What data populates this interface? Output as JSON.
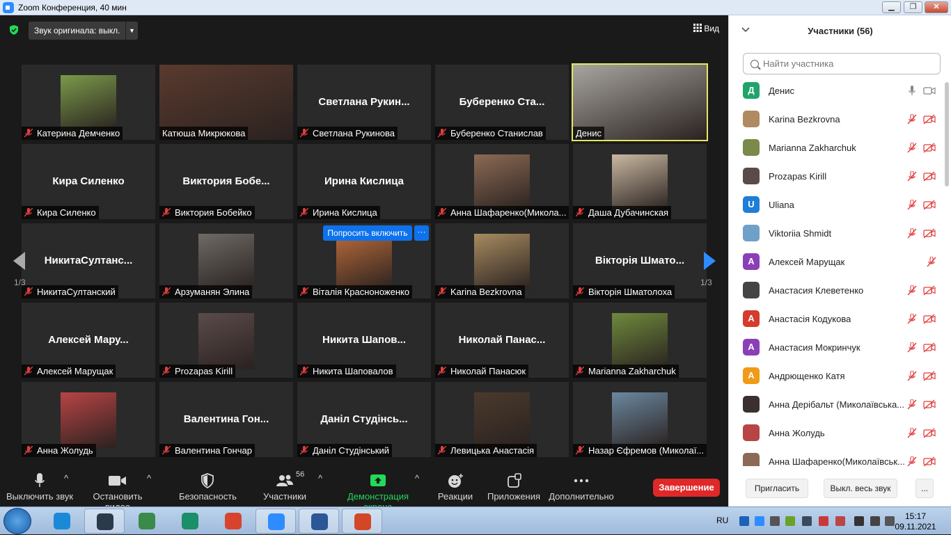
{
  "window": {
    "title": "Zoom Конференция, 40 мин",
    "btn_min": "▁",
    "btn_max": "❐",
    "btn_close": "✕"
  },
  "topbar": {
    "audio_label": "Звук оригинала: выкл.",
    "audio_caret": "▼",
    "view_label": "Вид"
  },
  "pager": {
    "left_text": "1/3",
    "right_text": "1/3"
  },
  "tiles": [
    {
      "name": "Катерина Демченко",
      "muted": true,
      "kind": "photo",
      "center_name": "",
      "tone": "#7a9a4a"
    },
    {
      "name": "Катюша Микрюкова",
      "muted": false,
      "kind": "full",
      "center_name": "",
      "tone": "#5a3a2e"
    },
    {
      "name": "Светлана Рукинова",
      "muted": true,
      "kind": "text",
      "center_name": "Светлана  Рукин...",
      "tone": ""
    },
    {
      "name": "Буберенко Станислав",
      "muted": true,
      "kind": "text",
      "center_name": "Буберенко  Ста...",
      "tone": ""
    },
    {
      "name": "Денис",
      "muted": false,
      "kind": "full",
      "center_name": "",
      "tone": "#a8a5a0",
      "active": true
    },
    {
      "name": "Кира Силенко",
      "muted": true,
      "kind": "text",
      "center_name": "Кира Силенко",
      "tone": ""
    },
    {
      "name": "Виктория Бобейко",
      "muted": true,
      "kind": "text",
      "center_name": "Виктория  Бобе...",
      "tone": ""
    },
    {
      "name": "Ирина Кислица",
      "muted": true,
      "kind": "text",
      "center_name": "Ирина Кислица",
      "tone": ""
    },
    {
      "name": "Анна Шафаренко(Микола...",
      "muted": true,
      "kind": "photo",
      "center_name": "",
      "tone": "#8c6a55"
    },
    {
      "name": "Даша Дубачинская",
      "muted": true,
      "kind": "photo",
      "center_name": "",
      "tone": "#c9b8a2"
    },
    {
      "name": "НикитаСултанский",
      "muted": true,
      "kind": "text",
      "center_name": "НикитаСултанс...",
      "tone": ""
    },
    {
      "name": "Арзуманян Элина",
      "muted": true,
      "kind": "photo",
      "center_name": "",
      "tone": "#6e6a66"
    },
    {
      "name": "Віталія Красноноженко",
      "muted": true,
      "kind": "photo",
      "center_name": "",
      "tone": "#b86a3a"
    },
    {
      "name": "Karina Bezkrovna",
      "muted": true,
      "kind": "photo",
      "center_name": "",
      "tone": "#a88b60"
    },
    {
      "name": "Вікторія Шматолоха",
      "muted": true,
      "kind": "text",
      "center_name": "Вікторія  Шмато...",
      "tone": ""
    },
    {
      "name": "Алексей Марущак",
      "muted": true,
      "kind": "text",
      "center_name": "Алексей  Мару...",
      "tone": ""
    },
    {
      "name": "Prozapas Kirill",
      "muted": true,
      "kind": "photo",
      "center_name": "",
      "tone": "#5c4b4b"
    },
    {
      "name": "Никита Шаповалов",
      "muted": true,
      "kind": "text",
      "center_name": "Никита  Шапов...",
      "tone": ""
    },
    {
      "name": "Николай Панасюк",
      "muted": true,
      "kind": "text",
      "center_name": "Николай  Панас...",
      "tone": ""
    },
    {
      "name": "Marianna Zakharchuk",
      "muted": true,
      "kind": "photo",
      "center_name": "",
      "tone": "#6f8a3c"
    },
    {
      "name": "Анна Жолудь",
      "muted": true,
      "kind": "photo",
      "center_name": "",
      "tone": "#b84444"
    },
    {
      "name": "Валентина Гончар",
      "muted": true,
      "kind": "text",
      "center_name": "Валентина  Гон...",
      "tone": ""
    },
    {
      "name": "Даніл Студінський",
      "muted": true,
      "kind": "text",
      "center_name": "Даніл  Студінсь...",
      "tone": ""
    },
    {
      "name": "Левицька Анастасія",
      "muted": true,
      "kind": "photo",
      "center_name": "",
      "tone": "#4a3a2c"
    },
    {
      "name": "Назар Єфремов (Миколаї...",
      "muted": true,
      "kind": "photo",
      "center_name": "",
      "tone": "#6b88a0"
    }
  ],
  "ask_button": {
    "label": "Попросить включить",
    "more": "···"
  },
  "toolbar": {
    "mute": "Выключить звук",
    "video": "Остановить видео",
    "security": "Безопасность",
    "participants": "Участники",
    "participants_count": "56",
    "share": "Демонстрация экрана",
    "reactions": "Реакции",
    "apps": "Приложения",
    "more": "Дополнительно",
    "end": "Завершение",
    "caret": "^"
  },
  "panel": {
    "title": "Участники (56)",
    "search_placeholder": "Найти участника",
    "invite": "Пригласить",
    "mute_all": "Выкл. весь звук",
    "more": "...",
    "participants": [
      {
        "name": "Денис",
        "initial": "Д",
        "color": "#21a36b",
        "muted": false,
        "video_off": false
      },
      {
        "name": "Karina Bezkrovna",
        "initial": "",
        "color": "#b08a60",
        "muted": true,
        "video_off": true
      },
      {
        "name": "Marianna Zakharchuk",
        "initial": "",
        "color": "#7a8a4a",
        "muted": true,
        "video_off": true
      },
      {
        "name": "Prozapas Kirill",
        "initial": "",
        "color": "#5a4a4a",
        "muted": true,
        "video_off": true
      },
      {
        "name": "Uliana",
        "initial": "U",
        "color": "#1e7ed8",
        "muted": true,
        "video_off": true
      },
      {
        "name": "Viktoriia Shmidt",
        "initial": "",
        "color": "#6fa0c8",
        "muted": true,
        "video_off": true
      },
      {
        "name": "Алексей Марущак",
        "initial": "А",
        "color": "#8a3fb8",
        "muted": true,
        "video_off": false
      },
      {
        "name": "Анастасия Клеветенко",
        "initial": "",
        "color": "#444444",
        "muted": true,
        "video_off": true
      },
      {
        "name": "Анастасія Кодукова",
        "initial": "А",
        "color": "#d43c2e",
        "muted": true,
        "video_off": true
      },
      {
        "name": "Анастасия Мокринчук",
        "initial": "А",
        "color": "#8a3fb8",
        "muted": true,
        "video_off": true
      },
      {
        "name": "Андрющенко Катя",
        "initial": "А",
        "color": "#f09a17",
        "muted": true,
        "video_off": true
      },
      {
        "name": "Анна Дерібальт (Миколаївська...",
        "initial": "",
        "color": "#3a3030",
        "muted": true,
        "video_off": true
      },
      {
        "name": "Анна Жолудь",
        "initial": "",
        "color": "#b84444",
        "muted": true,
        "video_off": true
      },
      {
        "name": "Анна Шафаренко(Миколаївськ...",
        "initial": "",
        "color": "#8c6a55",
        "muted": true,
        "video_off": true
      }
    ]
  },
  "taskbar": {
    "lang": "RU",
    "time": "15:17",
    "date": "09.11.2021",
    "apps": [
      {
        "name": "ie",
        "color": "#1a8ad8",
        "active": false
      },
      {
        "name": "scanner",
        "color": "#2a3a4a",
        "active": true
      },
      {
        "name": "media-player",
        "color": "#3a8a4a",
        "active": false
      },
      {
        "name": "edge",
        "color": "#1b8e6a",
        "active": false
      },
      {
        "name": "chrome",
        "color": "#d8432e",
        "active": false
      },
      {
        "name": "zoom",
        "color": "#2d8cff",
        "active": true
      },
      {
        "name": "word",
        "color": "#2b5797",
        "active": true
      },
      {
        "name": "powerpoint",
        "color": "#d24726",
        "active": true
      }
    ]
  },
  "colors": {
    "accent": "#2d8cff",
    "share_green": "#23d959",
    "end_red": "#e02828",
    "muted_red": "#e03e3e",
    "active_border": "#e4e860"
  }
}
